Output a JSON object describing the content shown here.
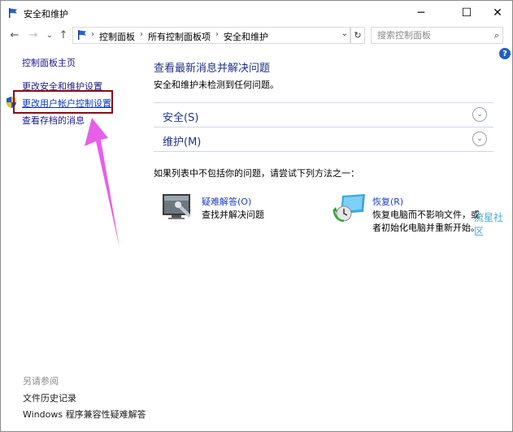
{
  "window": {
    "title": "安全和维护",
    "minimize": "─",
    "maximize": "☐",
    "close": "✕"
  },
  "nav": {
    "back": "←",
    "forward": "→",
    "recent": "⌄",
    "up": "↑",
    "breadcrumbs": [
      "控制面板",
      "所有控制面板项",
      "安全和维护"
    ],
    "separator": "›",
    "dropdown": "⌄",
    "refresh": "↻",
    "search_placeholder": "搜索控制面板",
    "help": "?"
  },
  "sidebar": {
    "home": "控制面板主页",
    "items": [
      {
        "label": "更改安全和维护设置"
      },
      {
        "label": "更改用户帐户控制设置"
      },
      {
        "label": "查看存档的消息"
      }
    ],
    "see_also_heading": "另请参阅",
    "see_also": [
      {
        "label": "文件历史记录"
      },
      {
        "label": "Windows 程序兼容性疑难解答"
      }
    ]
  },
  "main": {
    "title": "查看最新消息并解决问题",
    "subtitle": "安全和维护未检测到任何问题。",
    "sections": [
      {
        "label": "安全(S)",
        "chevron": "⌄"
      },
      {
        "label": "维护(M)",
        "chevron": "⌄"
      }
    ],
    "hint": "如果列表中不包括你的问题，请尝试下列方法之一：",
    "tools": [
      {
        "title": "疑难解答(O)",
        "desc": [
          "查找并解决问题"
        ]
      },
      {
        "title": "恢复(R)",
        "desc": [
          "恢复电脑而不影响文件，或",
          "者初始化电脑并重新开始。"
        ]
      }
    ]
  },
  "watermark": "流星社区",
  "colors": {
    "highlight_box": "#8b0a16",
    "arrow": "#e64ce8",
    "link": "#1a1a8c",
    "heading": "#1e3287"
  }
}
